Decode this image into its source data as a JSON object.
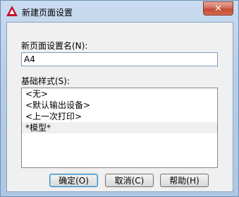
{
  "window": {
    "title": "新建页面设置",
    "close_symbol": "✕",
    "icon": "autocad-logo-icon",
    "accent_color": "#c8102e"
  },
  "form": {
    "name_label": "新页面设置名(N):",
    "name_value": "A4",
    "base_style_label": "基础样式(S):",
    "base_style_items": [
      "<无>",
      "<默认输出设备>",
      "<上一次打印>",
      "*模型*"
    ],
    "selected_index": 3
  },
  "buttons": {
    "ok": "确定(O)",
    "cancel": "取消(C)",
    "help": "帮助(H)"
  }
}
